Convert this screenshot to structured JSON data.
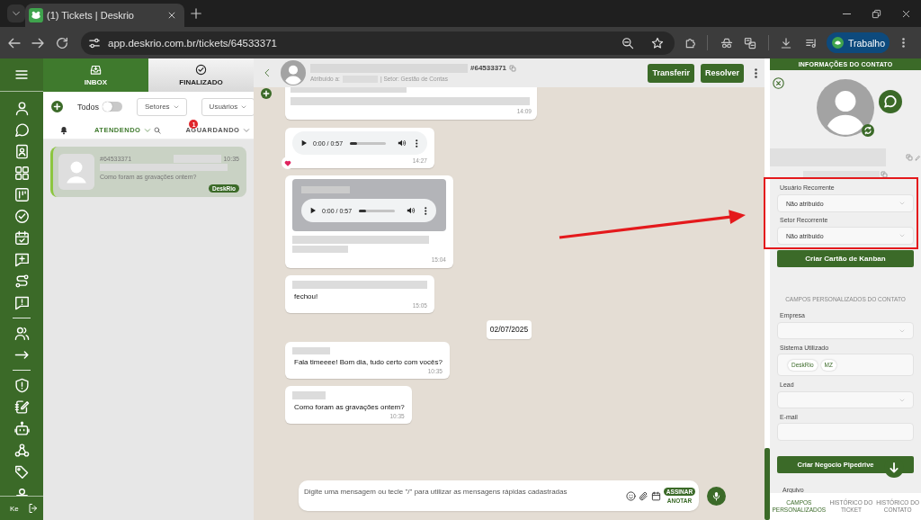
{
  "browser": {
    "tab_title": "(1) Tickets | Deskrio",
    "url": "app.deskrio.com.br/tickets/64533371",
    "profile": "Trabalho"
  },
  "sidebar": {
    "user_initials": "Ke"
  },
  "ticket_list": {
    "tabs": [
      {
        "label": "INBOX",
        "selected": true
      },
      {
        "label": "FINALIZADO",
        "selected": false
      }
    ],
    "toggle": {
      "label": "Todos",
      "on": false
    },
    "filters": [
      "Setores",
      "Usuários"
    ],
    "queues": [
      {
        "label": "ATENDENDO",
        "selected": true
      },
      {
        "label": "AGUARDANDO",
        "selected": false,
        "badge": "1"
      }
    ],
    "tickets": [
      {
        "number": "#64533371",
        "time": "10:35",
        "preview": "Como foram as gravações ontem?",
        "tag": "DeskRio",
        "selected": true
      }
    ]
  },
  "chat": {
    "ticket_number": "#64533371",
    "assigned_label": "Atribuido a:",
    "sector": "| Setor: Gestão de Contas",
    "actions": [
      "Transferir",
      "Resolver"
    ],
    "messages": [
      {
        "kind": "redacted",
        "time": "14:09",
        "reacted": false
      },
      {
        "kind": "audio",
        "player_time": "0:00 / 0:57",
        "level": 0,
        "time": "14:27",
        "reacted": true
      },
      {
        "kind": "quoted_audio",
        "player_time": "0:00 / 0:57",
        "level": 0,
        "time": "15:04",
        "reacted": false
      },
      {
        "kind": "text",
        "text": "fechou!",
        "time": "15:05",
        "reacted": false
      },
      {
        "kind": "date",
        "text": "02/07/2025"
      },
      {
        "kind": "text",
        "text": "Fala timeeee! Bom dia, tudo certo com vocês?",
        "time": "10:35",
        "reacted": false
      },
      {
        "kind": "text",
        "text": "Como foram as gravações ontem?",
        "time": "10:35",
        "reacted": false
      }
    ],
    "composer": {
      "placeholder": "Digite uma mensagem ou tecle \"/\" para utilizar as mensagens rápidas cadastradas",
      "sign_toggle": {
        "label": "ASSINAR",
        "on": true
      },
      "sign_caption": "ANOTAR"
    }
  },
  "contact": {
    "title": "INFORMAÇÕES DO CONTATO",
    "recurring": [
      {
        "label": "Usuário Recorrente",
        "value": "Não atribuido"
      },
      {
        "label": "Setor Recorrente",
        "value": "Não atribuido"
      }
    ],
    "kanban_button": "Criar Cartão de Kanban",
    "custom_fields_title": "CAMPOS PERSONALIZADOS DO CONTATO",
    "custom_fields": [
      {
        "kind": "select",
        "label": "Empresa"
      },
      {
        "kind": "chips",
        "label": "Sistema Utilizado",
        "chips": [
          "DeskRio",
          "MZ"
        ]
      },
      {
        "kind": "select",
        "label": "Lead"
      },
      {
        "kind": "input",
        "label": "E-mail"
      }
    ],
    "pipedrive_button": "Criar Negocio Pipedrive",
    "file_label": "Arquivo",
    "tabs": [
      {
        "label": "CAMPOS PERSONALIZADOS",
        "selected": true
      },
      {
        "label": "HISTÓRICO DO TICKET",
        "selected": false
      },
      {
        "label": "HISTÓRICO DO CONTATO",
        "selected": false
      }
    ]
  }
}
